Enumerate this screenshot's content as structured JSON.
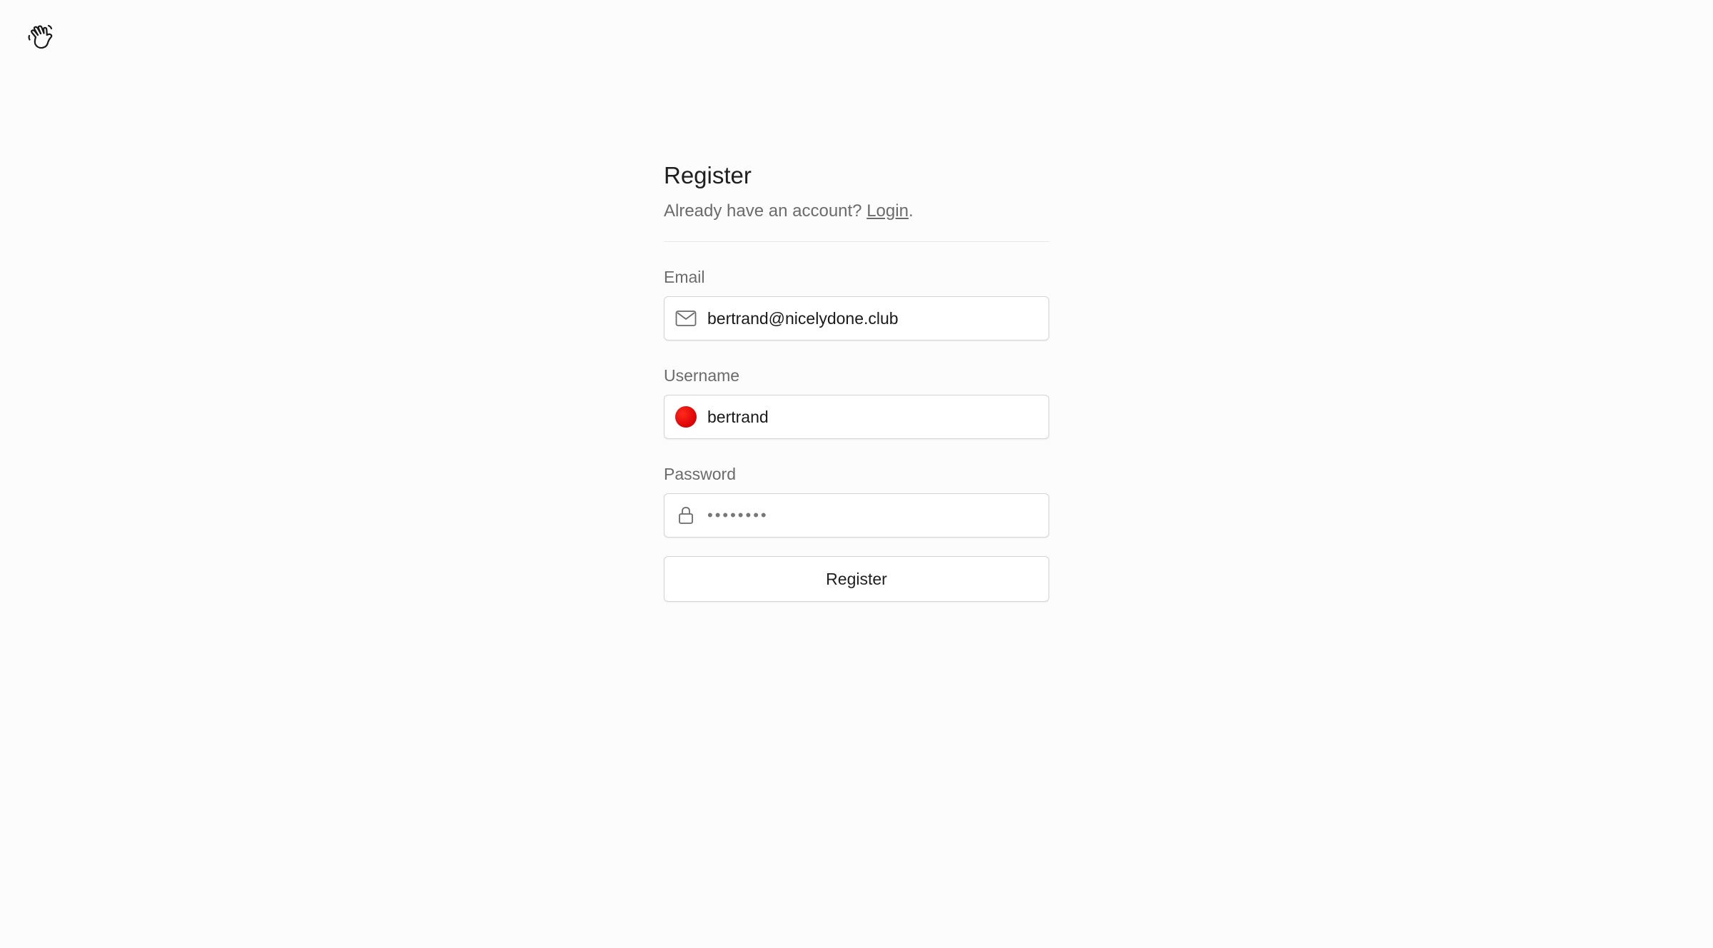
{
  "header": {
    "logo_icon": "waving-hand-icon"
  },
  "form": {
    "title": "Register",
    "subtitle_prefix": "Already have an account? ",
    "login_link": "Login",
    "subtitle_suffix": ".",
    "email": {
      "label": "Email",
      "value": "bertrand@nicelydone.club",
      "icon": "envelope-icon"
    },
    "username": {
      "label": "Username",
      "value": "bertrand",
      "avatar_color": "#e30a0a"
    },
    "password": {
      "label": "Password",
      "value": "••••••••",
      "icon": "lock-icon"
    },
    "submit_label": "Register"
  }
}
